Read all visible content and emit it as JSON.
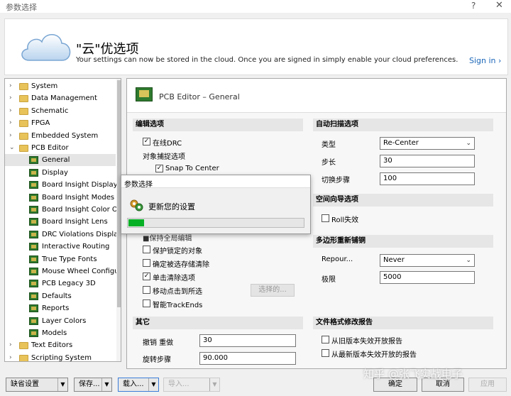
{
  "window": {
    "title": "参数选择",
    "help": "?",
    "close": "✕"
  },
  "header": {
    "title": "\"云\"优选项",
    "subtitle": "Your settings can now be stored in the cloud. Once you are signed in simply enable your cloud preferences.",
    "signin": "Sign in"
  },
  "tree": {
    "items": [
      {
        "label": "System",
        "kind": "folder",
        "level": 0,
        "chevron": "›"
      },
      {
        "label": "Data Management",
        "kind": "folder",
        "level": 0,
        "chevron": "›"
      },
      {
        "label": "Schematic",
        "kind": "folder",
        "level": 0,
        "chevron": "›"
      },
      {
        "label": "FPGA",
        "kind": "folder",
        "level": 0,
        "chevron": "›"
      },
      {
        "label": "Embedded System",
        "kind": "folder",
        "level": 0,
        "chevron": "›"
      },
      {
        "label": "PCB Editor",
        "kind": "folder",
        "level": 0,
        "chevron": "⌄"
      },
      {
        "label": "General",
        "kind": "pcb",
        "level": 1,
        "selected": true
      },
      {
        "label": "Display",
        "kind": "pcb",
        "level": 1
      },
      {
        "label": "Board Insight Display",
        "kind": "pcb",
        "level": 1
      },
      {
        "label": "Board Insight Modes",
        "kind": "pcb",
        "level": 1
      },
      {
        "label": "Board Insight Color Over",
        "kind": "pcb",
        "level": 1
      },
      {
        "label": "Board Insight Lens",
        "kind": "pcb",
        "level": 1
      },
      {
        "label": "DRC Violations Display",
        "kind": "pcb",
        "level": 1
      },
      {
        "label": "Interactive Routing",
        "kind": "pcb",
        "level": 1
      },
      {
        "label": "True Type Fonts",
        "kind": "pcb",
        "level": 1
      },
      {
        "label": "Mouse Wheel Configura",
        "kind": "pcb",
        "level": 1
      },
      {
        "label": "PCB Legacy 3D",
        "kind": "pcb",
        "level": 1
      },
      {
        "label": "Defaults",
        "kind": "pcb",
        "level": 1
      },
      {
        "label": "Reports",
        "kind": "pcb",
        "level": 1
      },
      {
        "label": "Layer Colors",
        "kind": "pcb",
        "level": 1
      },
      {
        "label": "Models",
        "kind": "pcb",
        "level": 1
      },
      {
        "label": "Text Editors",
        "kind": "folder",
        "level": 0,
        "chevron": "›"
      },
      {
        "label": "Scripting System",
        "kind": "folder",
        "level": 0,
        "chevron": "›"
      }
    ]
  },
  "panel": {
    "title": "PCB Editor – General",
    "edit_options": {
      "heading": "编辑选项",
      "online_drc": {
        "label": "在线DRC",
        "checked": true
      },
      "snap_heading": "对象捕捉选项",
      "snap_to_center": {
        "label": "Snap To Center",
        "checked": true
      },
      "partial_row": "■保持全局编辑",
      "protect_locked": {
        "label": "保护锁定的对象",
        "checked": false
      },
      "confirm_clear": {
        "label": "确定被选存储清除",
        "checked": false
      },
      "click_clear": {
        "label": "单击清除选项",
        "checked": true
      },
      "move_click": {
        "label": "移动点击到所选",
        "checked": false
      },
      "smart_track": {
        "label": "智能TrackEnds",
        "checked": false
      },
      "select_button": "选择的..."
    },
    "autopan": {
      "heading": "自动扫描选项",
      "type_label": "类型",
      "type_value": "Re-Center",
      "step_label": "步长",
      "step_value": "30",
      "shift_label": "切换步骤",
      "shift_value": "100"
    },
    "space_nav": {
      "heading": "空间向导选项",
      "roll": {
        "label": "Roll失效",
        "checked": false
      }
    },
    "polygon": {
      "heading": "多边形重新铺铜",
      "repour_label": "Repour...",
      "repour_value": "Never",
      "limit_label": "极限",
      "limit_value": "5000"
    },
    "other": {
      "heading": "其它",
      "undo_label": "撤销 重做",
      "undo_value": "30",
      "rotate_label": "旋转步骤",
      "rotate_value": "90.000"
    },
    "file_format": {
      "heading": "文件格式修改报告",
      "old_version": {
        "label": "从旧版本失效开放报告",
        "checked": false
      },
      "new_version": {
        "label": "从最新版本失效开放的报告",
        "checked": false
      }
    }
  },
  "progress_dialog": {
    "title": "参数选择",
    "message": "更新您的设置",
    "progress": 0.09,
    "color": "#06b025"
  },
  "footer": {
    "default_btn": "缺省设置",
    "save_btn": "保存...",
    "load_btn": "载入...",
    "import_btn": "导入...",
    "ok_btn": "确定",
    "cancel_btn": "取消",
    "apply_btn": "应用"
  },
  "watermark": "知乎 @张飞实战电子"
}
